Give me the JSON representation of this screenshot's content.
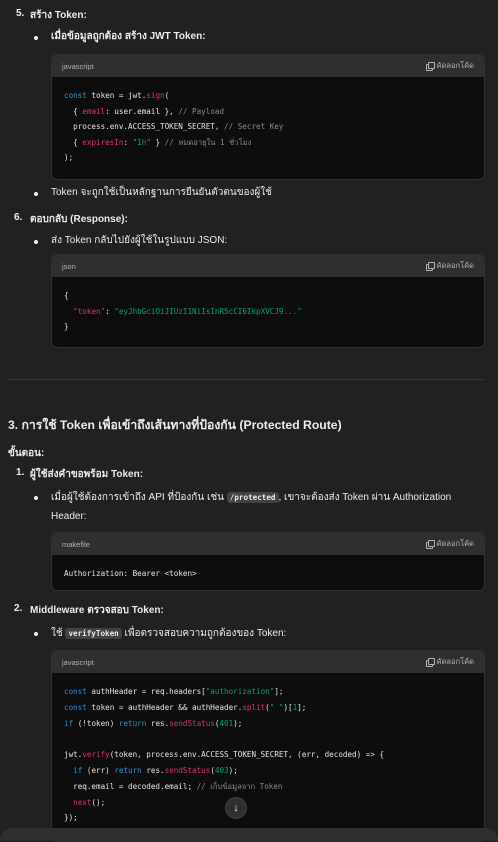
{
  "step5": {
    "number": "5.",
    "title": "สร้าง Token:",
    "bullet1": "เมื่อข้อมูลถูกต้อง สร้าง JWT Token:",
    "code_lang": "javascript",
    "copy_label": "คัดลอกโค้ด",
    "code": {
      "l1_a": "const",
      "l1_b": " token = jwt.",
      "l1_c": "sign",
      "l1_d": "(",
      "l2_a": "  { ",
      "l2_b": "email",
      "l2_c": ": user.email }, ",
      "l2_d": "// Payload",
      "l3_a": "  process.env.ACCESS_TOKEN_SECRET, ",
      "l3_b": "// Secret Key",
      "l4_a": "  { ",
      "l4_b": "expiresIn",
      "l4_c": ": ",
      "l4_d": "\"1h\"",
      "l4_e": " } ",
      "l4_f": "// หมดอายุใน 1 ชั่วโมง",
      "l5": ");"
    },
    "bullet2": "Token จะถูกใช้เป็นหลักฐานการยืนยันตัวตนของผู้ใช้"
  },
  "step6": {
    "number": "6.",
    "title": "ตอบกลับ (Response):",
    "bullet1": "ส่ง Token กลับไปยังผู้ใช้ในรูปแบบ JSON:",
    "code_lang": "json",
    "copy_label": "คัดลอกโค้ด",
    "code": {
      "l1": "{",
      "l2_key": "\"token\"",
      "l2_sep": ": ",
      "l2_val": "\"eyJhbGciOiJIUzI1NiIsInR5cCI6IkpXVCJ9...\"",
      "l3": "}"
    }
  },
  "section3": {
    "heading": "3. การใช้ Token เพื่อเข้าถึงเส้นทางที่ป้องกัน (Protected Route)",
    "steps_label": "ขั้นตอน:",
    "step1": {
      "number": "1.",
      "title": "ผู้ใช้ส่งคำขอพร้อม Token:",
      "bullet_pre": "เมื่อผู้ใช้ต้องการเข้าถึง API ที่ป้องกัน เช่น ",
      "bullet_code": "/protected",
      "bullet_post": ", เขาจะต้องส่ง Token ผ่าน Authorization",
      "bullet_line2": "Header:",
      "code_lang": "makefile",
      "copy_label": "คัดลอกโค้ด",
      "code_line": "Authorization: Bearer <token>"
    },
    "step2": {
      "number": "2.",
      "title": "Middleware ตรวจสอบ Token:",
      "bullet_pre": "ใช้ ",
      "bullet_code": "verifyToken",
      "bullet_post": " เพื่อตรวจสอบความถูกต้องของ Token:",
      "code_lang": "javascript",
      "copy_label": "คัดลอกโค้ด",
      "code": {
        "l1_a": "const",
        "l1_b": " authHeader = req.headers[",
        "l1_c": "\"authorization\"",
        "l1_d": "];",
        "l2_a": "const",
        "l2_b": " token = authHeader && authHeader.",
        "l2_c": "split",
        "l2_d": "(",
        "l2_e": "\" \"",
        "l2_f": ")[",
        "l2_g": "1",
        "l2_h": "];",
        "l3_a": "if",
        "l3_b": " (!token) ",
        "l3_c": "return",
        "l3_d": " res.",
        "l3_e": "sendStatus",
        "l3_f": "(",
        "l3_g": "401",
        "l3_h": ");",
        "l5_a": "jwt.",
        "l5_b": "verify",
        "l5_c": "(token, process.env.ACCESS_TOKEN_SECRET, (err, decoded) => {",
        "l6_a": "  if",
        "l6_b": " (err) ",
        "l6_c": "return",
        "l6_d": " res.",
        "l6_e": "sendStatus",
        "l6_f": "(",
        "l6_g": "403",
        "l6_h": ");",
        "l7_a": "  req.email = decoded.email; ",
        "l7_b": "// เก็บข้อมูลจาก Token",
        "l8_a": "  ",
        "l8_b": "next",
        "l8_c": "();",
        "l9": "});"
      }
    }
  },
  "scroll_down_symbol": "↓"
}
